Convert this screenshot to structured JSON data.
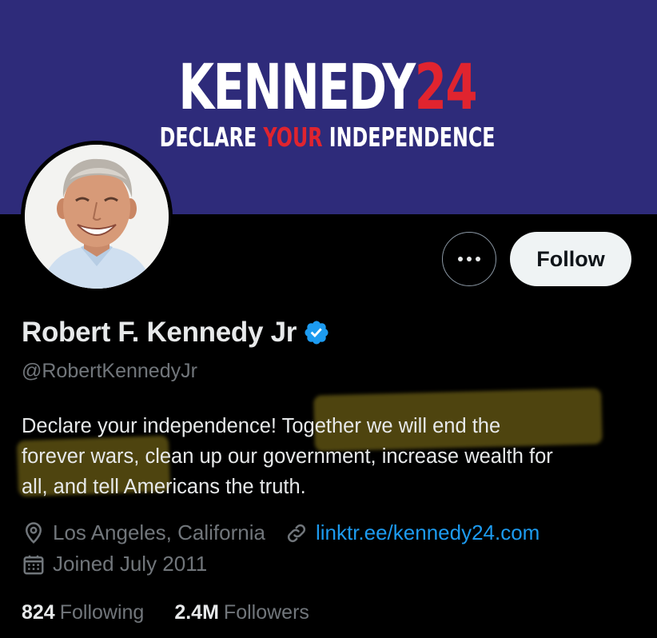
{
  "banner": {
    "title_name": "KENNEDY",
    "title_number": "24",
    "tagline_pre": "DECLARE ",
    "tagline_highlight": "YOUR",
    "tagline_post": " INDEPENDENCE",
    "background_color": "#2e2b7a",
    "accent_color": "#e0242f"
  },
  "profile": {
    "avatar_icon": "profile-photo",
    "display_name": "Robert F. Kennedy Jr",
    "verified_icon": "verified-badge-icon",
    "handle": "@RobertKennedyJr",
    "bio": {
      "line1": "Declare your independence! Together we will end the",
      "line2": "forever wars, clean up our government, increase wealth for",
      "line3": "all, and tell Americans the truth."
    },
    "location": "Los Angeles, California",
    "website": "linktr.ee/kennedy24.com",
    "joined": "Joined July 2011"
  },
  "actions": {
    "more_icon": "more-options-icon",
    "follow_label": "Follow"
  },
  "stats": {
    "following_count": "824",
    "following_label": "Following",
    "followers_count": "2.4M",
    "followers_label": "Followers"
  },
  "colors": {
    "link": "#1d9bf0",
    "secondary_text": "#71767b",
    "highlight": "#ccb228"
  }
}
